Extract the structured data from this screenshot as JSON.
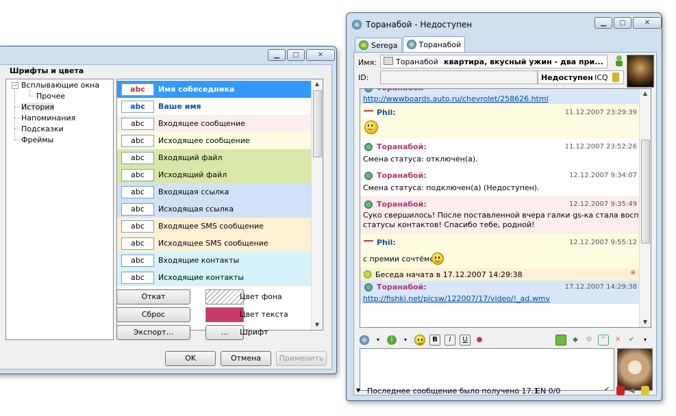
{
  "fonts_dialog": {
    "group_title": "Шрифты и цвета",
    "tree": [
      {
        "label": "Всплывающие окна"
      },
      {
        "label": "Прочее"
      },
      {
        "label": "История"
      },
      {
        "label": "Напоминания"
      },
      {
        "label": "Подсказки"
      },
      {
        "label": "Фреймы"
      }
    ],
    "sample_text": "abc",
    "color_items": [
      {
        "label": "Имя собеседника",
        "bg": "#3399ff",
        "bold": true,
        "selected": true,
        "abc_color": "#c0302a"
      },
      {
        "label": "Ваше имя",
        "bg": "#ffffff",
        "bold": true,
        "abc_color": "#0b4fa8"
      },
      {
        "label": "Входящее сообщение",
        "bg": "#fdeeee",
        "abc_color": "#000000"
      },
      {
        "label": "Исходящее сообщение",
        "bg": "#fefce0",
        "abc_color": "#000000"
      },
      {
        "label": "Входящий файл",
        "bg": "#d9e8a8",
        "abc_color": "#000000"
      },
      {
        "label": "Исходящий файл",
        "bg": "#d9e8a8",
        "abc_color": "#000000"
      },
      {
        "label": "Входящая ссылка",
        "bg": "#cfe2f8",
        "abc_color": "#000000"
      },
      {
        "label": "Исходящая ссылка",
        "bg": "#cfe2f8",
        "abc_color": "#000000"
      },
      {
        "label": "Входящее SMS сообщение",
        "bg": "#fdf0d3",
        "abc_color": "#000000"
      },
      {
        "label": "Исходящее SMS сообщение",
        "bg": "#fdf0d3",
        "abc_color": "#000000"
      },
      {
        "label": "Входящие контакты",
        "bg": "#d5f3f8",
        "abc_color": "#000000"
      },
      {
        "label": "Исходящие контакты",
        "bg": "#d5f3f8",
        "abc_color": "#000000"
      }
    ],
    "buttons": {
      "rollback": "Откат",
      "reset": "Сброс",
      "export": "Экспорт...",
      "font_btn": "...",
      "ok": "OK",
      "cancel": "Отмена",
      "apply": "Применить"
    },
    "swatch_labels": {
      "bg": "Цвет фона",
      "text": "Цвет текста",
      "font": "Шрифт"
    },
    "text_color": "#c8386a"
  },
  "chat_window": {
    "title": "Торанабой - Недоступен",
    "tabs": [
      {
        "label": "Serega"
      },
      {
        "label": "Торанабой"
      }
    ],
    "name_label": "Имя:",
    "name_value": "Торанабой",
    "status_message": "квартира, вкусный ужин - два при...",
    "id_label": "ID:",
    "status": "Недоступен",
    "protocol": "ICQ",
    "messages": [
      {
        "nick": "Торанабой",
        "time": "",
        "text": "http://wwwboards.auto.ru/chevrolet/258626.html",
        "link": true,
        "bg": "#d7e7f8",
        "nick_color": "#b8336a"
      },
      {
        "nick": "Phil:",
        "time": "11.12.2007 23:29:39",
        "text": "",
        "smiley": true,
        "bg": "#fefce0",
        "nick_color": "#1b4ea0"
      },
      {
        "nick": "Торанабой:",
        "time": "11.12.2007 23:52:26",
        "text": "Смена статуса: отключен(а).",
        "bg": "#ffffff",
        "nick_color": "#b8336a"
      },
      {
        "nick": "Торанабой:",
        "time": "12.12.2007 9:34:07",
        "text": "Смена статуса: подключен(а) (Недоступен).",
        "bg": "#ffffff",
        "nick_color": "#b8336a"
      },
      {
        "nick": "Торанабой:",
        "time": "12.12.2007 9:35:49",
        "text": "Суко свершилось! После поставленной вчера галки gs-ка стала воспринимать",
        "text2": "статусы контактов! Спасибо тебе, родной!",
        "bg": "#fdeeee",
        "nick_color": "#b8336a"
      },
      {
        "nick": "Phil:",
        "time": "12.12.2007 9:55:12",
        "text": "с премии сочтёмся",
        "smiley": true,
        "bg": "#fefce0",
        "nick_color": "#1b4ea0"
      },
      {
        "nick": "",
        "time": "",
        "text": "Беседа начата в 17.12.2007 14:29:38",
        "bg": "#fdf0d3",
        "nick_color": "#000000"
      },
      {
        "nick": "Торанабой:",
        "time": "17.12.2007 14:29:38",
        "text": "http://fishki.net/picsw/122007/17/video/!_ad.wmv",
        "link": true,
        "bg": "#d7e7f8",
        "nick_color": "#b8336a"
      }
    ],
    "status_bar": {
      "last_message": "Последнее сообщение было получено 17.1",
      "encoding": "EN 0/0"
    }
  }
}
